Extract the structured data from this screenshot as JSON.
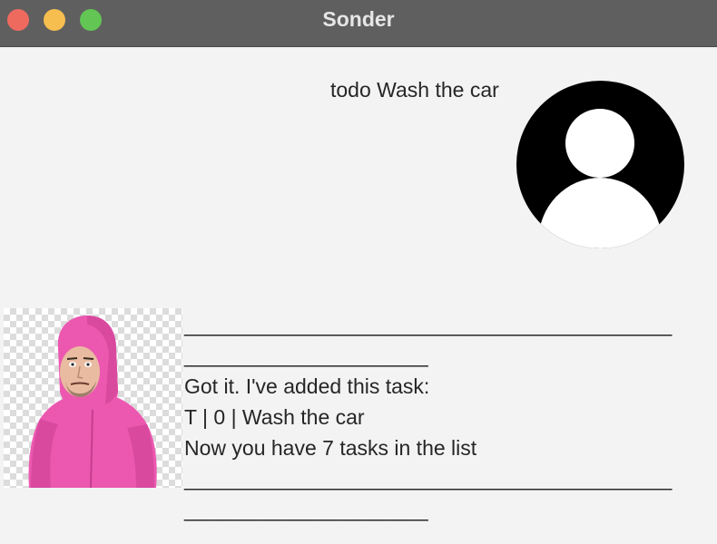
{
  "window": {
    "title": "Sonder"
  },
  "user_message": {
    "text": "todo Wash the car",
    "avatar_icon": "user-silhouette-icon"
  },
  "bot_message": {
    "avatar_icon": "pink-suit-man-photo",
    "lines": [
      "__________________________________________",
      "_____________________",
      "Got it. I've added this task:",
      "T | 0 | Wash the car",
      "Now you have 7 tasks in the list",
      "__________________________________________",
      "_____________________"
    ]
  },
  "colors": {
    "titlebar": "#5f5f5f",
    "background": "#f3f3f3",
    "close": "#ee6a5f",
    "minimize": "#f5be4f",
    "zoom": "#62c554",
    "suit_pink": "#ec58b0"
  }
}
